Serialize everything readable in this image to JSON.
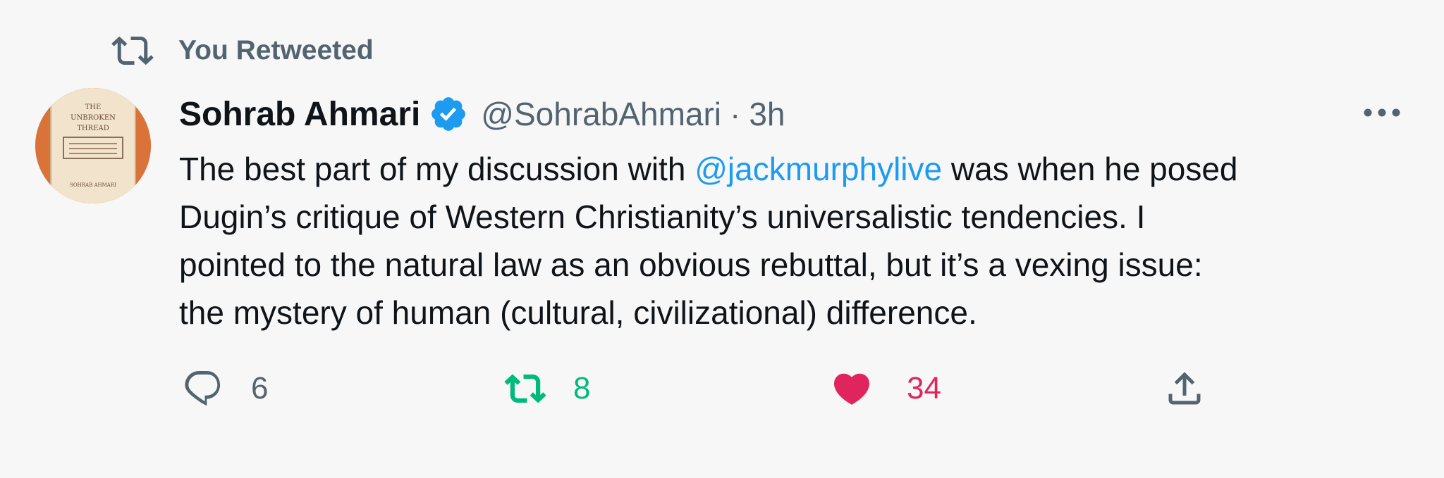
{
  "social_context": {
    "label": "You Retweeted"
  },
  "tweet": {
    "author_name": "Sohrab Ahmari",
    "handle": "@SohrabAhmari",
    "separator": "·",
    "time": "3h",
    "text": {
      "line1_before": "The best part of my discussion with ",
      "mention": "@jackmurphylive",
      "line1_after": " was when he posed",
      "line2": "Dugin’s critique of Western Christianity’s universalistic tendencies. I",
      "line3": "pointed to the natural law as an obvious rebuttal, but it’s a vexing issue:",
      "line4": "the mystery of human (cultural, civilizational) difference."
    },
    "avatar": {
      "book_lines": [
        "THE",
        "UNBROKEN",
        "THREAD",
        "SOHRAB AHMARI"
      ]
    }
  },
  "actions": {
    "reply": {
      "count": "6"
    },
    "retweet": {
      "count": "8"
    },
    "like": {
      "count": "34"
    }
  },
  "colors": {
    "background": "#f7f7f7",
    "text": "#0f1419",
    "secondary": "#536471",
    "link": "#1d9bf0",
    "retweet": "#00ba7c",
    "like": "#e0245e",
    "verified": "#1d9bf0"
  },
  "icons": [
    "retweet-icon",
    "verified-badge-icon",
    "more-icon",
    "reply-icon",
    "retweet-icon",
    "heart-icon",
    "share-icon"
  ]
}
